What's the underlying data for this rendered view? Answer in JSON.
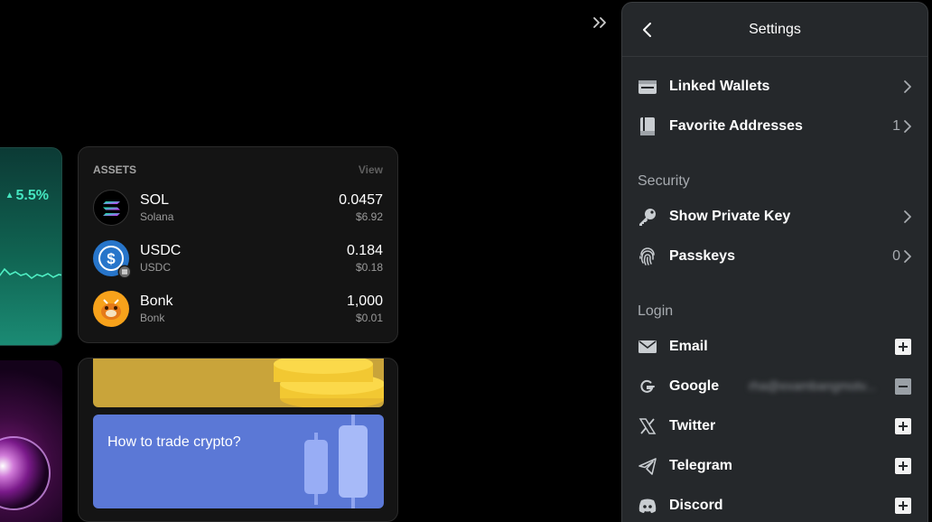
{
  "chart_card": {
    "change": "5.5%"
  },
  "assets": {
    "title": "ASSETS",
    "view": "View",
    "items": [
      {
        "symbol": "SOL",
        "name": "Solana",
        "amount": "0.0457",
        "usd": "$6.92"
      },
      {
        "symbol": "USDC",
        "name": "USDC",
        "amount": "0.184",
        "usd": "$0.18"
      },
      {
        "symbol": "Bonk",
        "name": "Bonk",
        "amount": "1,000",
        "usd": "$0.01"
      }
    ]
  },
  "learn": {
    "banner_text": "How to trade crypto?"
  },
  "settings": {
    "title": "Settings",
    "wallets": {
      "linked_wallets": "Linked Wallets",
      "favorite_addresses": "Favorite Addresses",
      "favorite_count": "1"
    },
    "security": {
      "label": "Security",
      "show_private_key": "Show Private Key",
      "passkeys": "Passkeys",
      "passkeys_count": "0"
    },
    "login": {
      "label": "Login",
      "email": "Email",
      "google": "Google",
      "google_account": "rha@exambangmotv...",
      "twitter": "Twitter",
      "telegram": "Telegram",
      "discord": "Discord"
    }
  },
  "colors": {
    "panel_bg": "#25282b",
    "accent_green": "#45e6c0",
    "banner_blue": "#5b78d6",
    "banner_gold": "#c9a43a"
  }
}
